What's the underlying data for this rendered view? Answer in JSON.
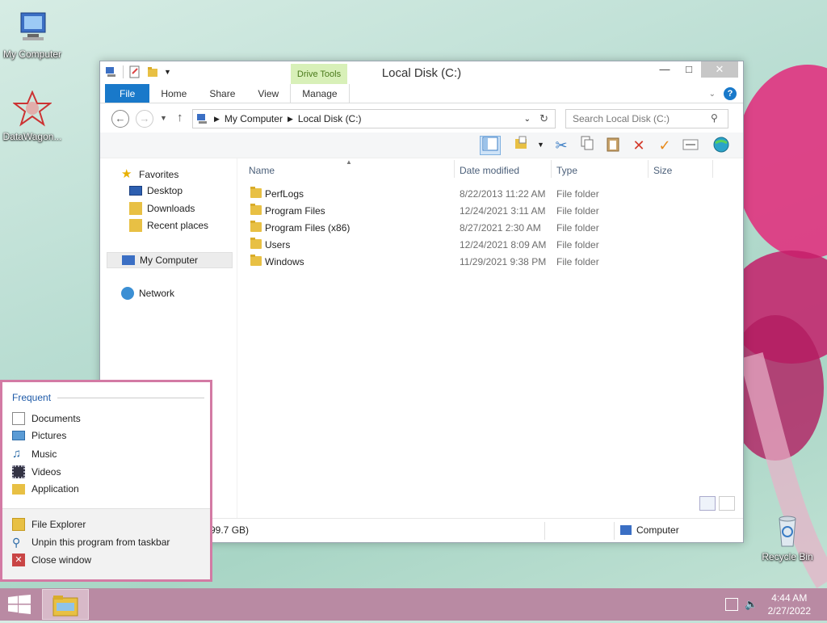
{
  "desktop": {
    "icons": [
      {
        "label": "My Computer"
      },
      {
        "label": "DataWagon..."
      },
      {
        "label": "Recycle Bin"
      }
    ]
  },
  "window": {
    "title": "Local Disk (C:)",
    "context_tab_header": "Drive Tools",
    "tabs": [
      {
        "label": "File"
      },
      {
        "label": "Home"
      },
      {
        "label": "Share"
      },
      {
        "label": "View"
      },
      {
        "label": "Manage"
      }
    ],
    "address": {
      "segments": [
        "My Computer",
        "Local Disk (C:)"
      ]
    },
    "search": {
      "placeholder": "Search Local Disk (C:)"
    },
    "nav": {
      "favorites": "Favorites",
      "items": [
        "Desktop",
        "Downloads",
        "Recent places"
      ],
      "computer": "My Computer",
      "network": "Network"
    },
    "columns": [
      "Name",
      "Date modified",
      "Type",
      "Size"
    ],
    "files": [
      {
        "name": "PerfLogs",
        "date": "8/22/2013 11:22 AM",
        "type": "File folder"
      },
      {
        "name": "Program Files",
        "date": "12/24/2021 3:11 AM",
        "type": "File folder"
      },
      {
        "name": "Program Files (x86)",
        "date": "8/27/2021 2:30 AM",
        "type": "File folder"
      },
      {
        "name": "Users",
        "date": "12/24/2021 8:09 AM",
        "type": "File folder"
      },
      {
        "name": "Windows",
        "date": "11/29/2021 9:38 PM",
        "type": "File folder"
      }
    ],
    "status": {
      "left": "99.7 GB)",
      "right": "Computer"
    }
  },
  "jumplist": {
    "heading": "Frequent",
    "frequent": [
      "Documents",
      "Pictures",
      "Music",
      "Videos",
      "Application"
    ],
    "tasks": [
      "File Explorer",
      "Unpin this program from taskbar",
      "Close window"
    ]
  },
  "taskbar": {
    "time": "4:44 AM",
    "date": "2/27/2022"
  },
  "colors": {
    "accent": "#1979ca",
    "jumplist_border": "#d37aa4",
    "taskbar": "#b98aa3",
    "drive_tools": "#d8f0b8"
  }
}
